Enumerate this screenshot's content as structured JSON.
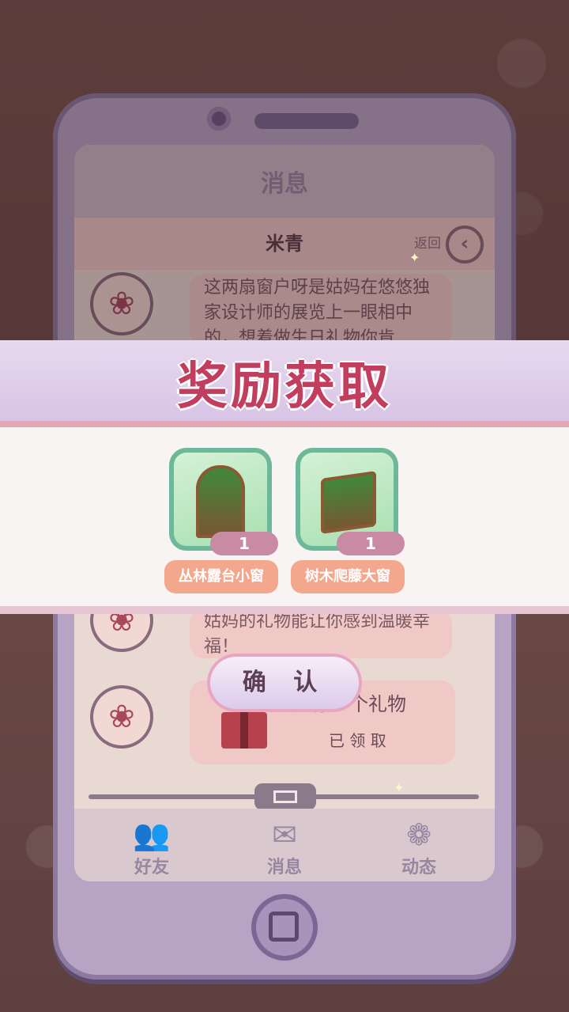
{
  "screen": {
    "title": "消息",
    "contact_name": "米青",
    "back_label": "返回",
    "messages": [
      {
        "text": "这两扇窗户呀是姑妈在悠悠独家设计师的展览上一眼相中的，想着做生日礼物你肯"
      },
      {
        "text": "姑妈的礼物能让你感到温暖幸福！"
      },
      {
        "gift_text": "送你一个礼物",
        "gift_status": "已 领 取"
      }
    ]
  },
  "tabs": [
    {
      "label": "好友",
      "icon": "friends-icon"
    },
    {
      "label": "消息",
      "icon": "message-icon"
    },
    {
      "label": "动态",
      "icon": "moments-icon"
    }
  ],
  "reward": {
    "title": "奖励获取",
    "items": [
      {
        "name": "丛林露台小窗",
        "quantity": "1",
        "icon": "jungle-window-icon"
      },
      {
        "name": "树木爬藤大窗",
        "quantity": "1",
        "icon": "vine-window-icon"
      }
    ],
    "confirm_label": "确 认"
  },
  "colors": {
    "title_pink": "#c23e5e",
    "item_name_bg": "#f3a88d",
    "item_card_border": "#6cb89a"
  }
}
